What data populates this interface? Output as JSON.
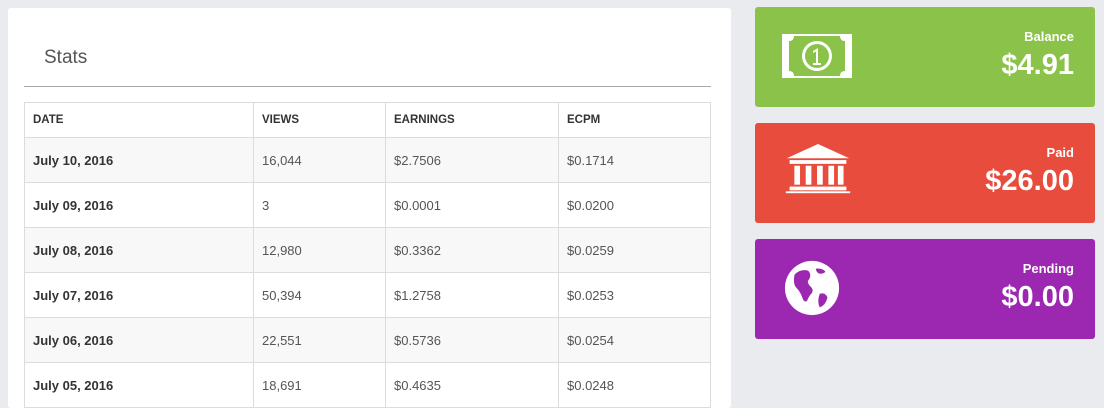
{
  "stats": {
    "title": "Stats",
    "columns": [
      "DATE",
      "VIEWS",
      "EARNINGS",
      "ECPM"
    ],
    "rows": [
      {
        "date": "July 10, 2016",
        "views": "16,044",
        "earnings": "$2.7506",
        "ecpm": "$0.1714"
      },
      {
        "date": "July 09, 2016",
        "views": "3",
        "earnings": "$0.0001",
        "ecpm": "$0.0200"
      },
      {
        "date": "July 08, 2016",
        "views": "12,980",
        "earnings": "$0.3362",
        "ecpm": "$0.0259"
      },
      {
        "date": "July 07, 2016",
        "views": "50,394",
        "earnings": "$1.2758",
        "ecpm": "$0.0253"
      },
      {
        "date": "July 06, 2016",
        "views": "22,551",
        "earnings": "$0.5736",
        "ecpm": "$0.0254"
      },
      {
        "date": "July 05, 2016",
        "views": "18,691",
        "earnings": "$0.4635",
        "ecpm": "$0.0248"
      }
    ]
  },
  "cards": {
    "balance": {
      "label": "Balance",
      "value": "$4.91",
      "color": "#8bc34a",
      "icon": "money-bill-icon"
    },
    "paid": {
      "label": "Paid",
      "value": "$26.00",
      "color": "#e74c3c",
      "icon": "bank-icon"
    },
    "pending": {
      "label": "Pending",
      "value": "$0.00",
      "color": "#9c27b0",
      "icon": "globe-icon"
    }
  }
}
